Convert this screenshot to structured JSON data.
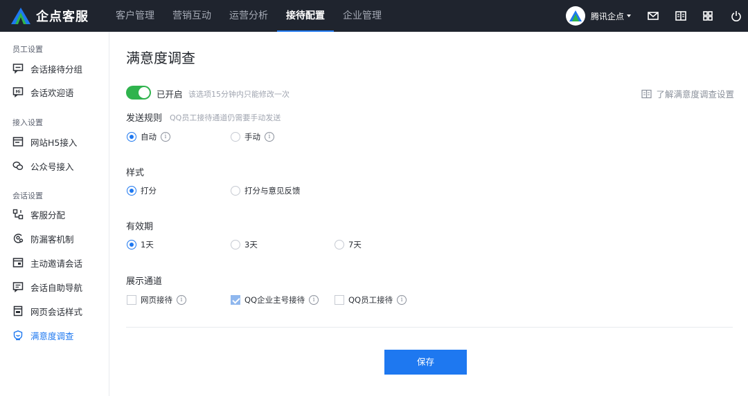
{
  "app": {
    "brand": "企点客服",
    "brand_color": "#1e78f0"
  },
  "nav": {
    "items": [
      {
        "label": "客户管理"
      },
      {
        "label": "营销互动"
      },
      {
        "label": "运营分析"
      },
      {
        "label": "接待配置",
        "active": true
      },
      {
        "label": "企业管理"
      }
    ]
  },
  "user": {
    "name": "腾讯企点"
  },
  "top_icons": [
    "mail-icon",
    "book-icon",
    "apps-grid-icon",
    "logout-icon"
  ],
  "sidebar": {
    "groups": [
      {
        "title": "员工设置",
        "items": [
          {
            "label": "会话接待分组",
            "icon": "chat-group-icon"
          },
          {
            "label": "会话欢迎语",
            "icon": "hi-message-icon"
          }
        ]
      },
      {
        "title": "接入设置",
        "items": [
          {
            "label": "网站H5接入",
            "icon": "web-window-icon"
          },
          {
            "label": "公众号接入",
            "icon": "wechat-icon"
          }
        ]
      },
      {
        "title": "会话设置",
        "items": [
          {
            "label": "客服分配",
            "icon": "distribute-icon"
          },
          {
            "label": "防漏客机制",
            "icon": "shield-user-icon"
          },
          {
            "label": "主动邀请会话",
            "icon": "invite-icon"
          },
          {
            "label": "会话自助导航",
            "icon": "nav-message-icon"
          },
          {
            "label": "网页会话样式",
            "icon": "page-style-icon"
          },
          {
            "label": "满意度调查",
            "icon": "satisfaction-icon",
            "active": true
          }
        ]
      }
    ]
  },
  "main": {
    "title": "满意度调查",
    "toggle": {
      "label": "已开启",
      "on": true,
      "hint": "该选项15分钟内只能修改一次"
    },
    "learn_link": "了解满意度调查设置",
    "send_rule": {
      "label": "发送规则",
      "hint": "QQ员工接待通道仍需要手动发送",
      "options": [
        {
          "label": "自动",
          "selected": true
        },
        {
          "label": "手动",
          "selected": false
        }
      ]
    },
    "style": {
      "label": "样式",
      "options": [
        {
          "label": "打分",
          "selected": true
        },
        {
          "label": "打分与意见反馈",
          "selected": false
        }
      ]
    },
    "validity": {
      "label": "有效期",
      "options": [
        {
          "label": "1天",
          "selected": true
        },
        {
          "label": "3天",
          "selected": false
        },
        {
          "label": "7天",
          "selected": false
        }
      ]
    },
    "channels": {
      "label": "展示通道",
      "options": [
        {
          "label": "网页接待",
          "checked": false
        },
        {
          "label": "QQ企业主号接待",
          "checked": true
        },
        {
          "label": "QQ员工接待",
          "checked": false
        }
      ]
    },
    "save_label": "保存"
  }
}
